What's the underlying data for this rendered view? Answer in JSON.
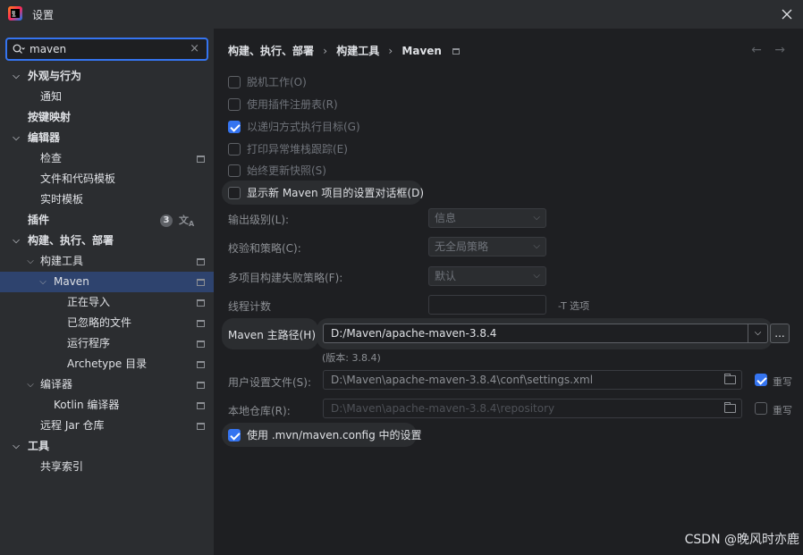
{
  "window": {
    "title": "设置"
  },
  "search": {
    "value": "maven"
  },
  "sidebar": {
    "items": [
      {
        "label": "外观与行为"
      },
      {
        "label": "通知"
      },
      {
        "label": "按键映射"
      },
      {
        "label": "编辑器"
      },
      {
        "label": "检查"
      },
      {
        "label": "文件和代码模板"
      },
      {
        "label": "实时模板"
      },
      {
        "label": "插件",
        "badge": "3"
      },
      {
        "label": "构建、执行、部署"
      },
      {
        "label": "构建工具"
      },
      {
        "label": "Maven"
      },
      {
        "label": "正在导入"
      },
      {
        "label": "已忽略的文件"
      },
      {
        "label": "运行程序"
      },
      {
        "label": "Archetype 目录"
      },
      {
        "label": "编译器"
      },
      {
        "label": "Kotlin 编译器"
      },
      {
        "label": "远程 Jar 仓库"
      },
      {
        "label": "工具"
      },
      {
        "label": "共享索引"
      }
    ]
  },
  "breadcrumb": {
    "part1": "构建、执行、部署",
    "sep": "›",
    "part2": "构建工具",
    "part3": "Maven"
  },
  "nav": {
    "back": "←",
    "forward": "→"
  },
  "options": {
    "offline": "脱机工作(O)",
    "plugin_registry": "使用插件注册表(R)",
    "recursive": "以递归方式执行目标(G)",
    "print_stack": "打印异常堆栈跟踪(E)",
    "always_update": "始终更新快照(S)",
    "show_dialog": "显示新 Maven 项目的设置对话框(D)"
  },
  "form": {
    "output_level_label": "输出级别(L):",
    "output_level_value": "信息",
    "checksum_label": "校验和策略(C):",
    "checksum_value": "无全局策略",
    "failure_label": "多项目构建失败策略(F):",
    "failure_value": "默认",
    "threads_label": "线程计数",
    "threads_suffix": "-T 选项",
    "maven_home_label": "Maven 主路径(H):",
    "maven_home_value": "D:/Maven/apache-maven-3.8.4",
    "browse": "...",
    "version": "(版本: 3.8.4)",
    "user_settings_label": "用户设置文件(S):",
    "user_settings_value": "D:\\Maven\\apache-maven-3.8.4\\conf\\settings.xml",
    "override1": "重写",
    "local_repo_label": "本地仓库(R):",
    "local_repo_value": "D:\\Maven\\apache-maven-3.8.4\\repository",
    "override2": "重写",
    "use_mvn_config": "使用 .mvn/maven.config 中的设置"
  },
  "watermark": "CSDN @晚风时亦鹿",
  "colors": {
    "accent": "#3574f0",
    "selection": "#2e436e",
    "background": "#1e1f22",
    "panel": "#2b2d30"
  }
}
